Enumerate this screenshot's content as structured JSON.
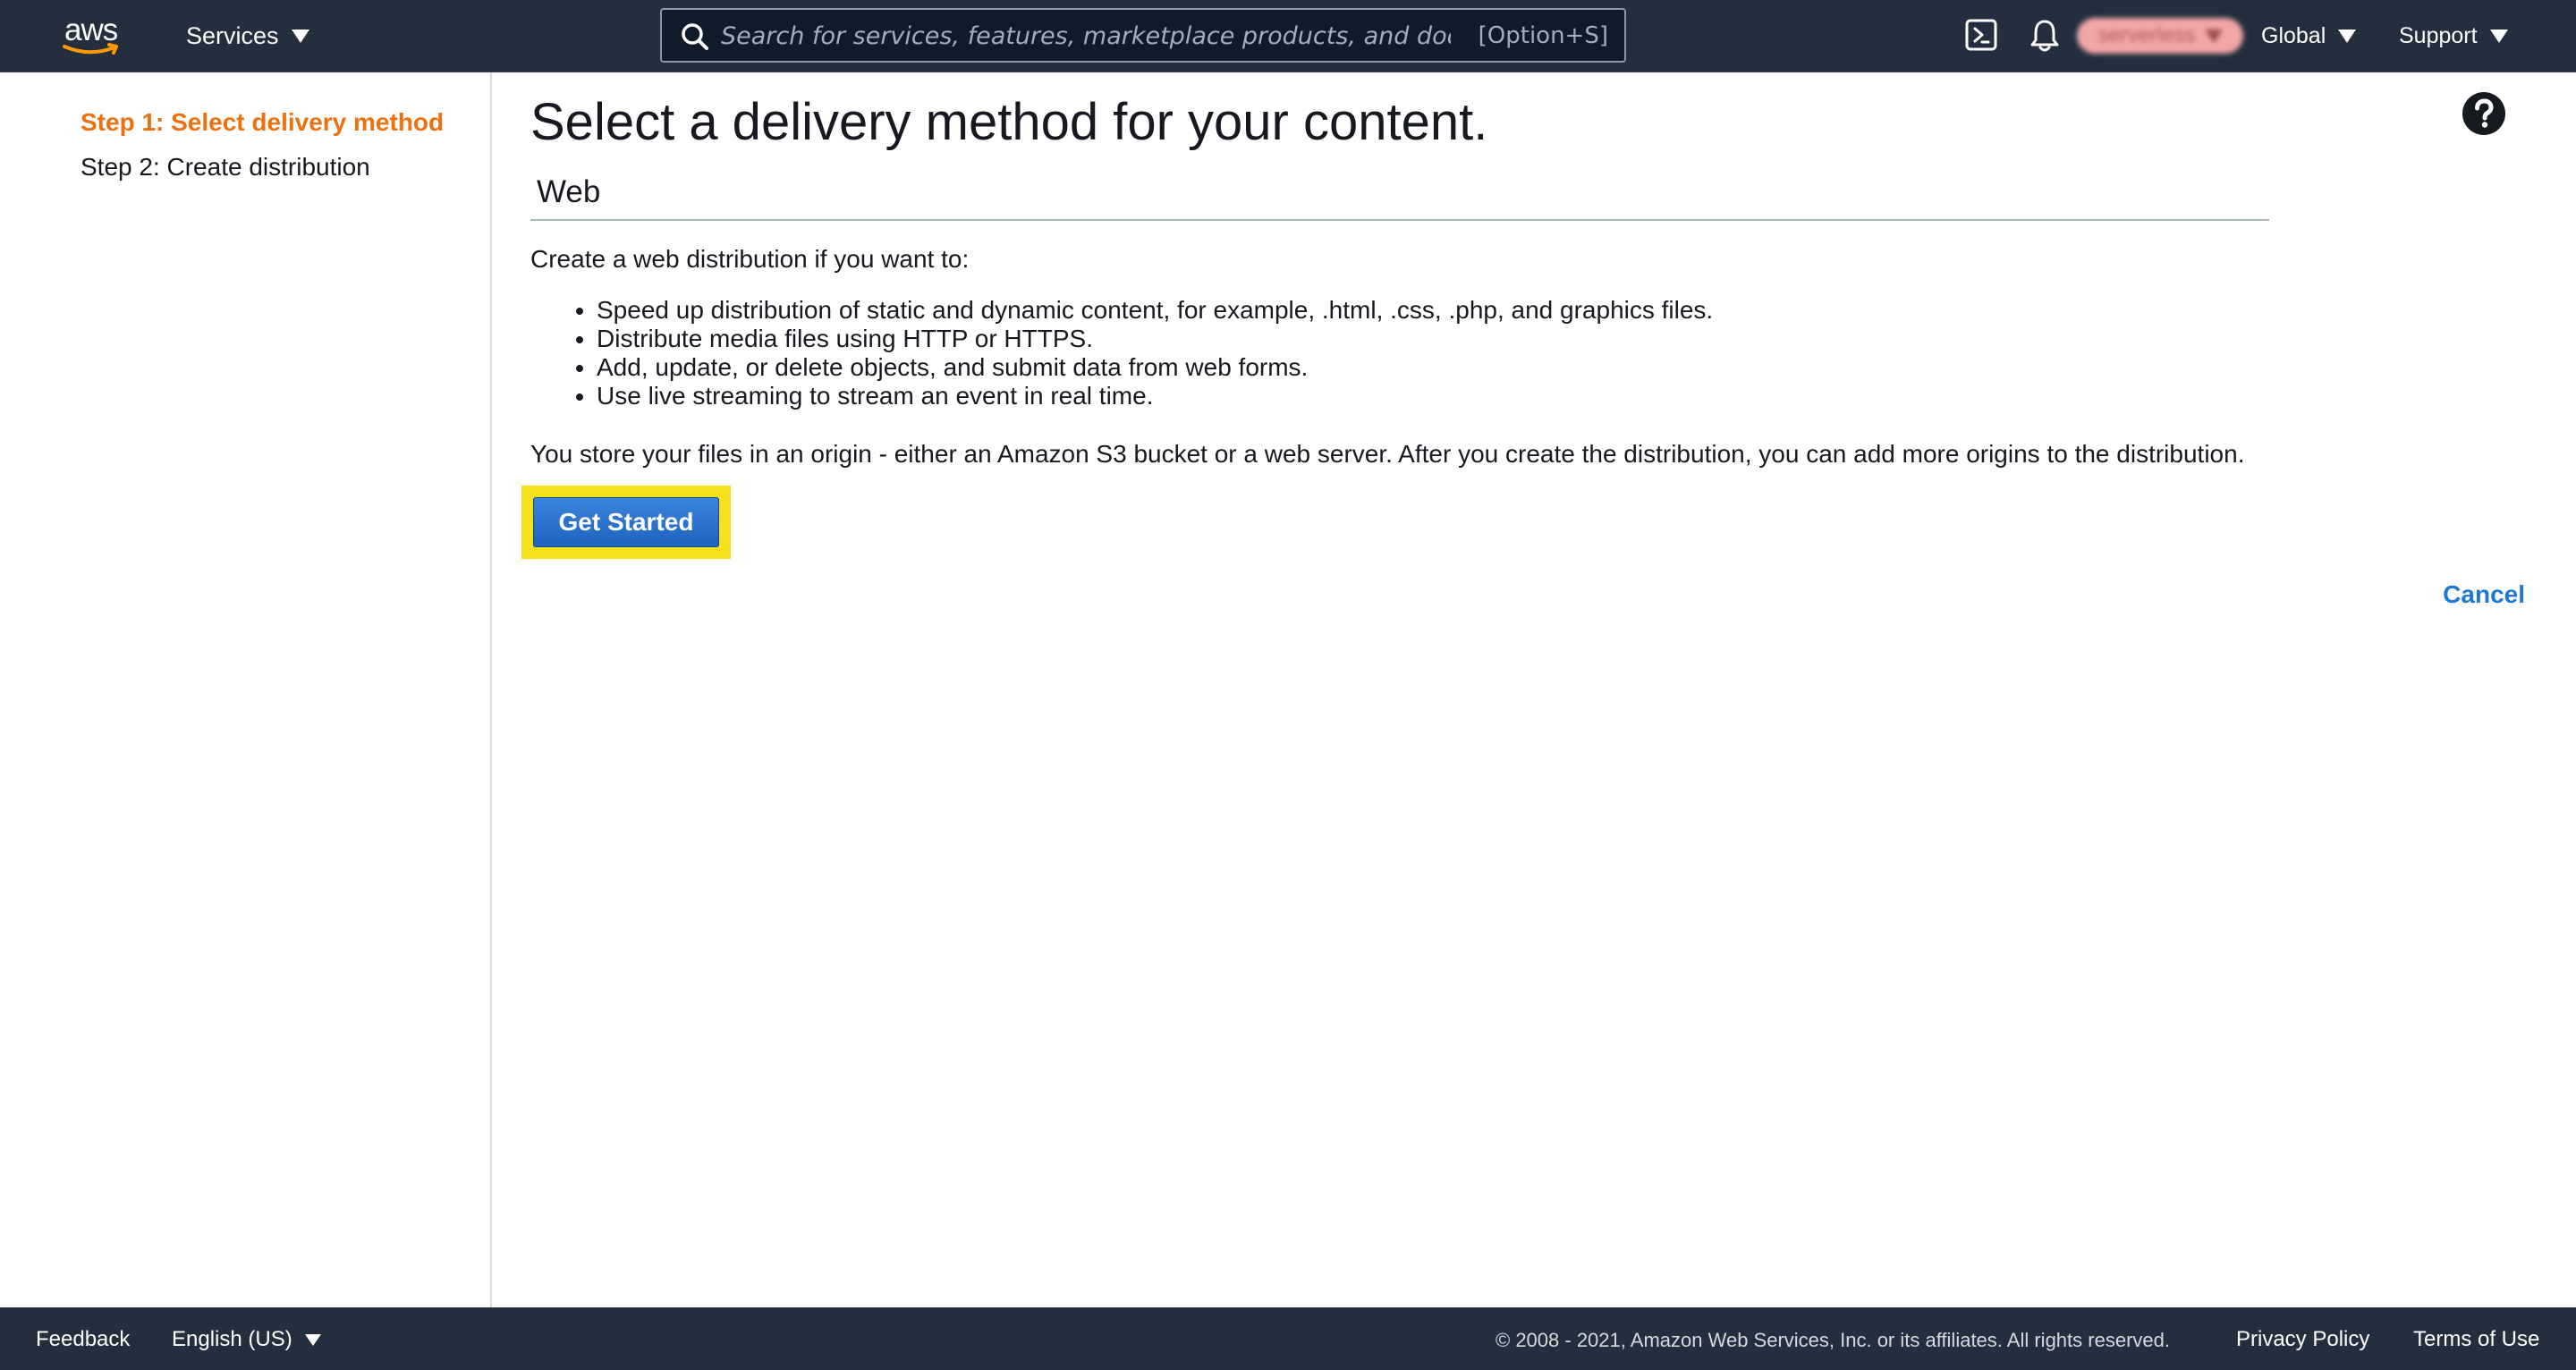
{
  "nav": {
    "logo_text": "aws",
    "services_label": "Services",
    "search": {
      "placeholder": "Search for services, features, marketplace products, and docs",
      "value": "",
      "shortcut": "[Option+S]"
    },
    "account_label": "serverless",
    "region_label": "Global",
    "support_label": "Support",
    "icons": [
      "cloudshell-icon",
      "bell-icon",
      "search-icon"
    ]
  },
  "sidebar": {
    "steps": [
      {
        "label": "Step 1: Select delivery method",
        "active": true
      },
      {
        "label": "Step 2: Create distribution",
        "active": false
      }
    ]
  },
  "main": {
    "title": "Select a delivery method for your content.",
    "section_title": "Web",
    "intro": "Create a web distribution if you want to:",
    "bullets": [
      "Speed up distribution of static and dynamic content, for example, .html, .css, .php, and graphics files.",
      "Distribute media files using HTTP or HTTPS.",
      "Add, update, or delete objects, and submit data from web forms.",
      "Use live streaming to stream an event in real time."
    ],
    "origin_note": "You store your files in an origin - either an Amazon S3 bucket or a web server. After you create the distribution, you can add more origins to the distribution.",
    "get_started_label": "Get Started",
    "cancel_label": "Cancel"
  },
  "footer": {
    "feedback_label": "Feedback",
    "language_label": "English (US)",
    "copyright": "© 2008 - 2021, Amazon Web Services, Inc. or its affiliates. All rights reserved.",
    "privacy_label": "Privacy Policy",
    "terms_label": "Terms of Use"
  },
  "colors": {
    "nav_bg": "#232f3e",
    "active_step": "#ec7211",
    "primary_button": "#1f63bd",
    "link": "#1f78d1",
    "highlight": "#f5e21d"
  }
}
